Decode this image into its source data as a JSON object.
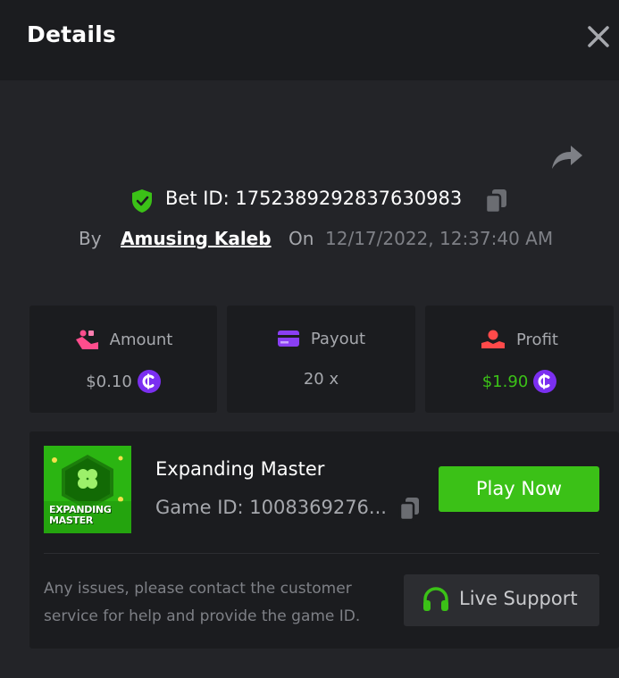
{
  "header": {
    "title": "Details",
    "close_icon": "close-icon"
  },
  "bet": {
    "bet_id_text": "Bet ID: 1752389292837630983",
    "by_label": "By",
    "user": "Amusing Kaleb",
    "on_label": "On",
    "date": "12/17/2022, 12:37:40 AM"
  },
  "stats": [
    {
      "label": "Amount",
      "value": "$0.10",
      "icon": "amount-icon",
      "value_color": "#a6a8ad",
      "has_coin": true
    },
    {
      "label": "Payout",
      "value": "20 x",
      "icon": "payout-card-icon",
      "value_color": "#a6a8ad",
      "has_coin": false
    },
    {
      "label": "Profit",
      "value": "$1.90",
      "icon": "profit-hand-icon",
      "value_color": "#3bc117",
      "has_coin": true
    }
  ],
  "coin_glyph": "C",
  "game": {
    "name": "Expanding Master",
    "id_text": "Game ID: 1008369276...",
    "thumb_text_line1": "EXPANDING",
    "thumb_text_line2": "MASTER",
    "play_label": "Play Now"
  },
  "support": {
    "text": "Any issues, please contact the customer service for help and provide the game ID.",
    "button_label": "Live Support"
  },
  "colors": {
    "accent_green": "#3bc117",
    "coin_purple": "#7b2ff0",
    "amount_pink": "#ff4d8d",
    "profit_red": "#ff4a4a",
    "payout_purple": "#8a3ff4"
  }
}
